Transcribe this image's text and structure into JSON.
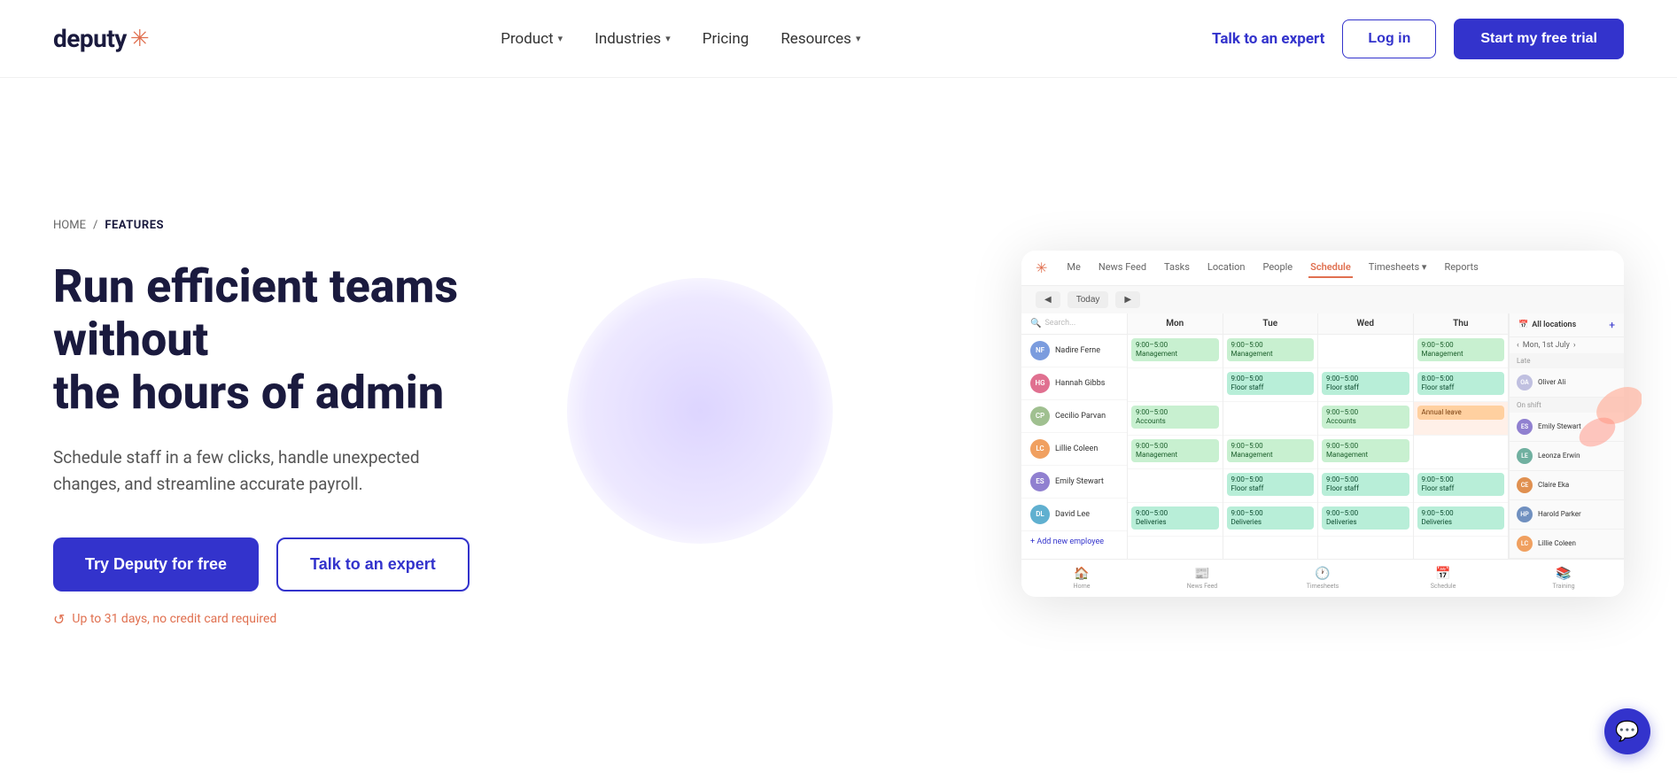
{
  "nav": {
    "logo_text": "deputy",
    "logo_star": "✳",
    "links": [
      {
        "id": "product",
        "label": "Product",
        "has_chevron": true
      },
      {
        "id": "industries",
        "label": "Industries",
        "has_chevron": true
      },
      {
        "id": "pricing",
        "label": "Pricing",
        "has_chevron": false
      },
      {
        "id": "resources",
        "label": "Resources",
        "has_chevron": true
      }
    ],
    "cta_expert": "Talk to an expert",
    "btn_login": "Log in",
    "btn_trial": "Start my free trial"
  },
  "breadcrumb": {
    "home": "HOME",
    "separator": "/",
    "current": "FEATURES"
  },
  "hero": {
    "heading_line1": "Run efficient teams without",
    "heading_line2": "the hours of admin",
    "subtext": "Schedule staff in a few clicks, handle unexpected changes, and streamline accurate payroll.",
    "btn_primary": "Try Deputy for free",
    "btn_secondary": "Talk to an expert",
    "trial_note": "Up to 31 days, no credit card required"
  },
  "app_ui": {
    "tabs": [
      "Me",
      "News Feed",
      "Tasks",
      "Location",
      "People",
      "Schedule",
      "Timesheets",
      "Reports"
    ],
    "active_tab": "Schedule",
    "toolbar_btns": [
      "",
      "",
      ""
    ],
    "all_locations": "All locations",
    "date_header": "Mon, 1st July",
    "search_placeholder": "Search...",
    "day_headers": [
      "Mon",
      "Tue",
      "Wed",
      "Thu"
    ],
    "staff": [
      {
        "name": "Nadire Ferne",
        "color": "#7b9cde",
        "initials": "NF",
        "shifts": [
          {
            "day": 0,
            "time": "9:00 - 5:00",
            "dept": "Management",
            "type": "green"
          },
          {
            "day": 1,
            "time": "9:00 - 5:00",
            "dept": "Management",
            "type": "green"
          },
          {
            "day": 3,
            "time": "9:00 - 5:00",
            "dept": "Management",
            "type": "green"
          }
        ]
      },
      {
        "name": "Hannah Gibbs",
        "color": "#e07090",
        "initials": "HG",
        "shifts": [
          {
            "day": 1,
            "time": "9:00 - 5:00",
            "dept": "Floor staff",
            "type": "teal"
          },
          {
            "day": 2,
            "time": "9:00 - 5:00",
            "dept": "Floor staff",
            "type": "teal"
          },
          {
            "day": 3,
            "time": "8:00 - 5:00",
            "dept": "Floor staff",
            "type": "teal"
          }
        ]
      },
      {
        "name": "Cecilia Parvan",
        "color": "#a0c090",
        "initials": "CP",
        "shifts": [
          {
            "day": 0,
            "time": "9:00 - 5:00",
            "dept": "Accounts",
            "type": "green"
          },
          {
            "day": 2,
            "time": "9:00 - 5:00",
            "dept": "Accounts",
            "type": "green"
          }
        ]
      },
      {
        "name": "Lillie Coleen",
        "color": "#f0a060",
        "initials": "LC",
        "shifts": [
          {
            "day": 0,
            "time": "9:00 - 5:00",
            "dept": "Management",
            "type": "green"
          },
          {
            "day": 1,
            "time": "9:00 - 5:00",
            "dept": "Management",
            "type": "green"
          },
          {
            "day": 2,
            "time": "9:00 - 5:00",
            "dept": "Management",
            "type": "green"
          }
        ]
      },
      {
        "name": "Emily Stewart",
        "color": "#9080d0",
        "initials": "ES",
        "shifts": [
          {
            "day": 1,
            "time": "9:00 - 5:00",
            "dept": "Floor staff",
            "type": "teal"
          },
          {
            "day": 2,
            "time": "9:00 - 5:00",
            "dept": "Floor staff",
            "type": "teal"
          },
          {
            "day": 3,
            "time": "9:00 - 5:00",
            "dept": "Floor staff",
            "type": "teal"
          }
        ]
      },
      {
        "name": "David Lee",
        "color": "#60b0d0",
        "initials": "DL",
        "shifts": [
          {
            "day": 0,
            "time": "9:00 - 5:00",
            "dept": "Deliveries",
            "type": "teal"
          },
          {
            "day": 1,
            "time": "9:00 - 5:00",
            "dept": "Deliveries",
            "type": "teal"
          },
          {
            "day": 2,
            "time": "9:00 - 5:00",
            "dept": "Deliveries",
            "type": "teal"
          },
          {
            "day": 3,
            "time": "9:00 - 5:00",
            "dept": "Deliveries",
            "type": "teal"
          }
        ]
      }
    ],
    "right_panel_label_late": "Late",
    "right_panel_label_onshift": "On shift",
    "right_staff": [
      "Oliver Ali",
      "Emily Stewart",
      "Leonza Erwin",
      "Claire Eka",
      "Harold Parker",
      "Lillie Coleen"
    ],
    "add_employee": "+ Add new employee",
    "bottom_nav": [
      "Home",
      "News Feed",
      "Timesheets",
      "Schedule",
      "Training"
    ]
  },
  "chat": {
    "icon": "💬"
  }
}
